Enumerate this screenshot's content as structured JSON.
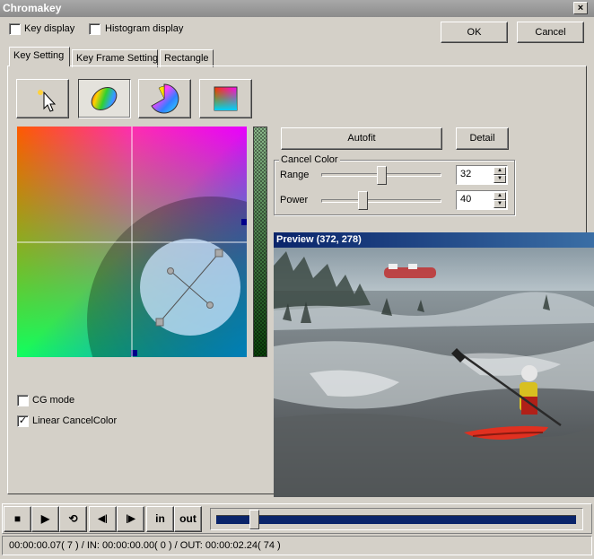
{
  "window": {
    "title": "Chromakey",
    "close_glyph": "×"
  },
  "options": {
    "key_display": {
      "label": "Key display",
      "checked": false
    },
    "histogram_display": {
      "label": "Histogram display",
      "checked": false
    }
  },
  "buttons": {
    "ok": "OK",
    "cancel": "Cancel",
    "autofit": "Autofit",
    "detail": "Detail"
  },
  "tabs": [
    {
      "label": "Key Setting",
      "active": true
    },
    {
      "label": "Key Frame Setting",
      "active": false
    },
    {
      "label": "Rectangle",
      "active": false
    }
  ],
  "tools": [
    {
      "name": "pointer-tool-icon",
      "pressed": false
    },
    {
      "name": "ellipse-key-tool-icon",
      "pressed": true
    },
    {
      "name": "fan-key-tool-icon",
      "pressed": false
    },
    {
      "name": "color-square-tool-icon",
      "pressed": false
    }
  ],
  "cancel_color": {
    "title": "Cancel Color",
    "range": {
      "label": "Range",
      "value": "32",
      "slider_fraction": 0.5
    },
    "power": {
      "label": "Power",
      "value": "40",
      "slider_fraction": 0.33
    }
  },
  "mode_options": {
    "cg_mode": {
      "label": "CG mode",
      "checked": false
    },
    "linear_cancel_color": {
      "label": "Linear CancelColor",
      "checked": true,
      "glyph": "✓"
    }
  },
  "preview": {
    "title": "Preview (372, 278)"
  },
  "transport": {
    "in_label": "in",
    "out_label": "out",
    "timeline_position": 0.095,
    "stop_glyph": "■",
    "play_glyph": "▶",
    "loop_glyph": "⟲",
    "prev_glyph": "◀|",
    "next_glyph": "|▶"
  },
  "status": {
    "text": "00:00:00.07( 7 ) / IN: 00:00:00.00( 0 ) / OUT: 00:00:02.24( 74 )"
  },
  "colors": {
    "title_bar": "#9a9a9a",
    "preview_title": "#0a246a",
    "timeline": "#0a246a",
    "window_bg": "#d4d0c8"
  }
}
